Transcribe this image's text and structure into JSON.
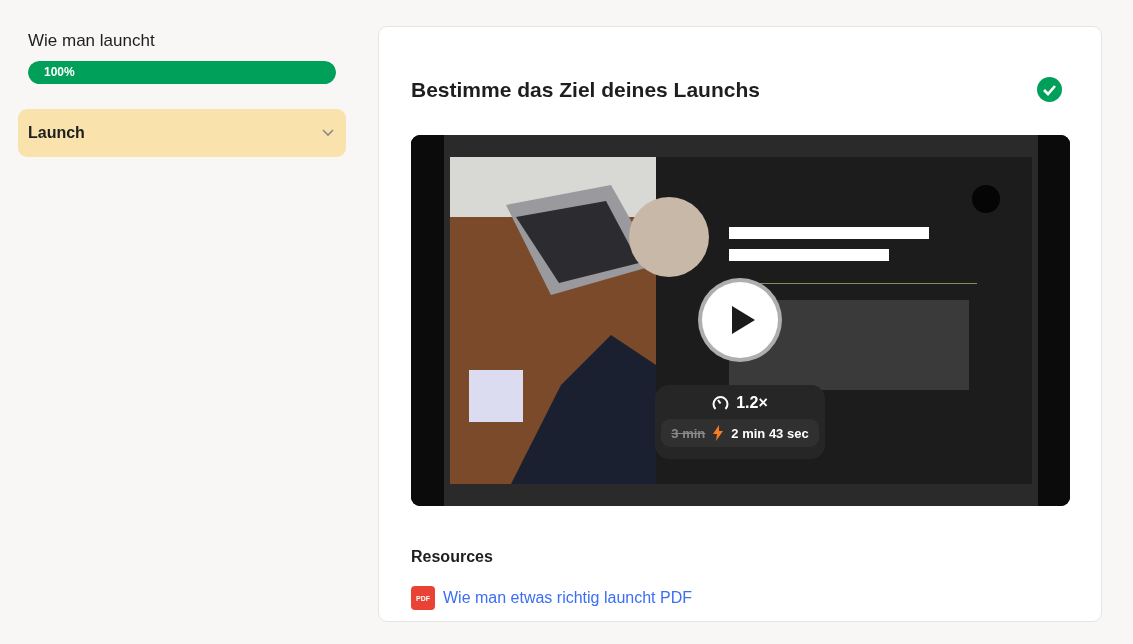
{
  "sidebar": {
    "course_title": "Wie man launcht",
    "progress": {
      "level": 1,
      "label": "100%"
    },
    "sections": [
      {
        "label": "Launch",
        "selected": true,
        "expanded": false
      }
    ]
  },
  "lesson": {
    "title": "Bestimme das Ziel deines Launchs",
    "completed": true,
    "video": {
      "kind": "picture",
      "speed": "1.2×",
      "original_duration": "3 min",
      "new_duration": "2 min 43 sec"
    },
    "resources": {
      "heading": "Resources",
      "items": [
        {
          "badge": "PDF",
          "label": "Wie man etwas richtig launcht PDF"
        }
      ]
    }
  }
}
